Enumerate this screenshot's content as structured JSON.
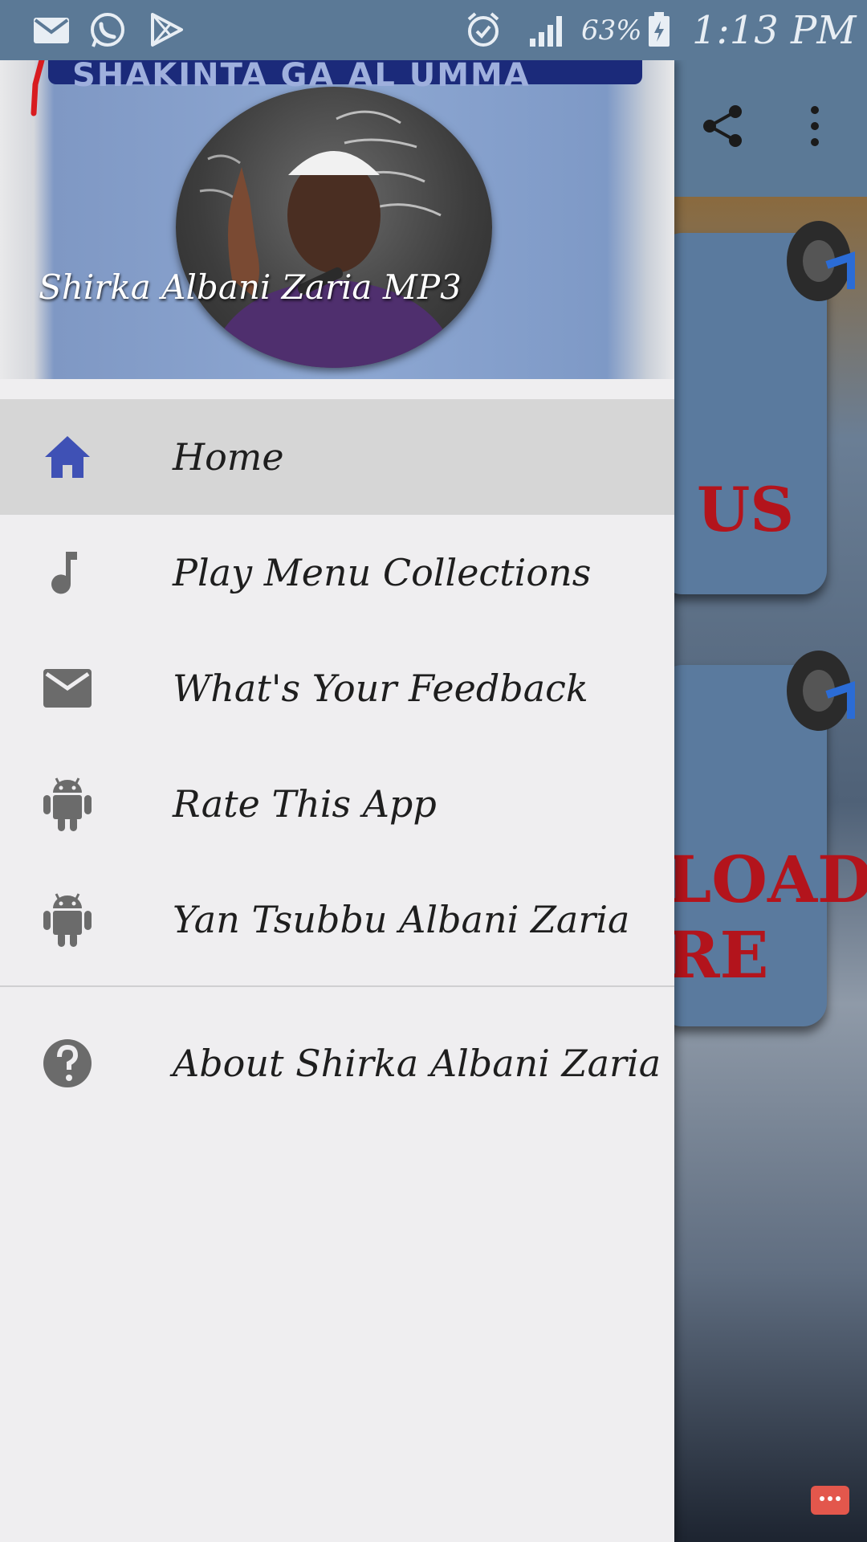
{
  "status_bar": {
    "notification_icons": [
      "mail-icon",
      "whatsapp-icon",
      "play-store-icon"
    ],
    "system_icons": [
      "alarm-icon",
      "signal-icon",
      "battery-charging-icon"
    ],
    "battery": "63%",
    "time": "1:13 PM"
  },
  "toolbar": {
    "icons": [
      "share-icon",
      "overflow-menu-icon"
    ]
  },
  "background_tiles": [
    {
      "text": "US"
    },
    {
      "text": "LOAD\nRE"
    }
  ],
  "drawer": {
    "header": {
      "banner_text": "SHAKINTA GA AL UMMA",
      "title": "Shirka Albani Zaria MP3"
    },
    "items": [
      {
        "label": "Home",
        "icon": "home-icon",
        "active": true
      },
      {
        "label": "Play Menu Collections",
        "icon": "music-note-icon",
        "active": false
      },
      {
        "label": "What's Your Feedback",
        "icon": "mail-icon",
        "active": false
      },
      {
        "label": "Rate This App",
        "icon": "android-icon",
        "active": false
      },
      {
        "label": "Yan Tsubbu Albani Zaria",
        "icon": "android-icon",
        "active": false
      }
    ],
    "secondary_items": [
      {
        "label": "About Shirka Albani Zaria",
        "icon": "help-icon"
      }
    ]
  },
  "colors": {
    "status_bar": "#5b7996",
    "active_icon": "#3f51b5",
    "icon_gray": "#6b6b6b",
    "active_row": "#d6d6d6",
    "drawer_bg": "#efeef0"
  }
}
